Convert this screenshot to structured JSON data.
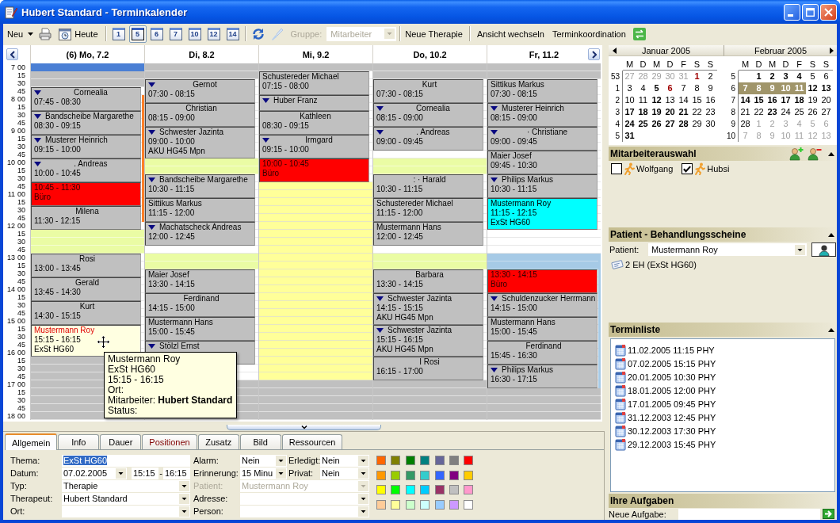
{
  "window": {
    "title": "Hubert Standard - Terminkalender"
  },
  "toolbar": {
    "new": "Neu",
    "today": "Heute",
    "day_views": [
      {
        "label": "1",
        "selected": false
      },
      {
        "label": "5",
        "selected": true
      },
      {
        "label": "6",
        "selected": false
      },
      {
        "label": "7",
        "selected": false
      },
      {
        "label": "10",
        "selected": false
      },
      {
        "label": "12",
        "selected": false
      },
      {
        "label": "14",
        "selected": false
      }
    ],
    "group": {
      "label": "Gruppe:",
      "value": "Mitarbeiter",
      "disabled": true
    },
    "new_therapy": "Neue Therapie",
    "switch_view": "Ansicht wechseln",
    "coordination": "Terminkoordination"
  },
  "calendar": {
    "times": [
      {
        "hour": "7",
        "quarters": [
          "00",
          "15",
          "30",
          "45"
        ]
      },
      {
        "hour": "8",
        "quarters": [
          "00",
          "15",
          "30",
          "45"
        ]
      },
      {
        "hour": "9",
        "quarters": [
          "00",
          "15",
          "30",
          "45"
        ]
      },
      {
        "hour": "10",
        "quarters": [
          "00",
          "15",
          "30",
          "45"
        ]
      },
      {
        "hour": "11",
        "quarters": [
          "00",
          "15",
          "30",
          "45"
        ]
      },
      {
        "hour": "12",
        "quarters": [
          "00",
          "15",
          "30",
          "45"
        ]
      },
      {
        "hour": "13",
        "quarters": [
          "00",
          "15",
          "30",
          "45"
        ]
      },
      {
        "hour": "14",
        "quarters": [
          "00",
          "15",
          "30",
          "45"
        ]
      },
      {
        "hour": "15",
        "quarters": [
          "00",
          "15",
          "30",
          "45"
        ]
      },
      {
        "hour": "16",
        "quarters": [
          "00",
          "15",
          "30",
          "45"
        ]
      },
      {
        "hour": "17",
        "quarters": [
          "00",
          "15",
          "30",
          "45"
        ]
      },
      {
        "hour": "18",
        "quarters": [
          "00"
        ]
      }
    ],
    "days": [
      {
        "header": "(6) Mo, 7.2",
        "blocks": [
          {
            "kind": "selected"
          },
          {
            "kind": "off"
          },
          {
            "kind": "off"
          },
          {
            "kind": "short",
            "title": "Cornealia",
            "time": "07:45 - 08:30",
            "marker": true,
            "color": "#c0c0c0",
            "selected": false
          },
          {
            "kind": "full",
            "title": "Bandscheibe Margarethe",
            "time": "08:30 - 09:15",
            "marker": true,
            "color": "#c0c0c0",
            "selected": false
          },
          {
            "kind": "full",
            "title": "Musterer Heinrich",
            "time": "09:15 - 10:00",
            "marker": true,
            "color": "#c0c0c0",
            "selected": false
          },
          {
            "kind": "short",
            "title": ". Andreas",
            "time": "10:00 - 10:45",
            "marker": true,
            "color": "#c0c0c0",
            "selected": false
          },
          {
            "kind": "block",
            "time": "10:45 - 11:30",
            "note": "Büro",
            "marker": false,
            "color": "#ff0000",
            "selected": false
          },
          {
            "kind": "short",
            "title": "Milena",
            "time": "11:30 - 12:15",
            "marker": false,
            "color": "#c0c0c0",
            "selected": false
          },
          {
            "kind": "break"
          },
          {
            "kind": "break"
          },
          {
            "kind": "break"
          },
          {
            "kind": "short",
            "title": "Rosi",
            "time": "13:00 - 13:45",
            "marker": false,
            "color": "#c0c0c0",
            "selected": false
          },
          {
            "kind": "short",
            "title": "Gerald",
            "time": "13:45 - 14:30",
            "marker": false,
            "color": "#c0c0c0",
            "selected": false
          },
          {
            "kind": "short",
            "title": "Kurt",
            "time": "14:30 - 15:15",
            "marker": false,
            "color": "#c0c0c0",
            "selected": false
          },
          {
            "kind": "full",
            "title": "Mustermann Roy",
            "time": "15:15 - 16:15",
            "note": "ExSt HG60",
            "marker": false,
            "color": "#ffffe1",
            "selected": true
          },
          {
            "kind": "off"
          },
          {
            "kind": "off"
          },
          {
            "kind": "off"
          },
          {
            "kind": "off"
          },
          {
            "kind": "off"
          },
          {
            "kind": "off"
          },
          {
            "kind": "off"
          },
          {
            "kind": "off"
          }
        ],
        "bar": [
          {
            "kind": "gap"
          },
          {
            "kind": "gap"
          },
          {
            "kind": "gap"
          },
          {
            "kind": "gap"
          },
          {
            "kind": "bar",
            "color": "#ff7f27"
          },
          {
            "kind": "extend"
          },
          {
            "kind": "extend"
          },
          {
            "kind": "extend"
          },
          {
            "kind": "extend"
          },
          {
            "kind": "extend"
          },
          {
            "kind": "extend"
          },
          {
            "kind": "extend"
          },
          {
            "kind": "extend"
          },
          {
            "kind": "extend"
          },
          {
            "kind": "extend"
          },
          {
            "kind": "extend"
          },
          {
            "kind": "extend"
          },
          {
            "kind": "extend"
          },
          {
            "kind": "extend"
          },
          {
            "kind": "extend"
          }
        ]
      },
      {
        "header": "Di, 8.2",
        "blocks": [
          {
            "kind": "off"
          },
          {
            "kind": "off"
          },
          {
            "kind": "short",
            "title": "Gernot",
            "time": "07:30 - 08:15",
            "marker": true,
            "color": "#c0c0c0",
            "selected": false
          },
          {
            "kind": "short",
            "title": "Christian",
            "time": "08:15 - 09:00",
            "marker": false,
            "color": "#c0c0c0",
            "selected": false
          },
          {
            "kind": "full",
            "title": "Schwester Jazinta",
            "time": "09:00 - 10:00",
            "note": "AKU HG45 Mpn",
            "marker": true,
            "color": "#c0c0c0",
            "selected": false
          },
          {
            "kind": "break"
          },
          {
            "kind": "break"
          },
          {
            "kind": "full",
            "title": "Bandscheibe Margarethe",
            "time": "10:30 - 11:15",
            "marker": true,
            "color": "#c0c0c0",
            "selected": false
          },
          {
            "kind": "full",
            "title": "Sittikus Markus",
            "time": "11:15 - 12:00",
            "marker": false,
            "color": "#c0c0c0",
            "selected": false
          },
          {
            "kind": "full",
            "title": "Machatscheck Andreas",
            "time": "12:00 - 12:45",
            "marker": true,
            "color": "#c0c0c0",
            "selected": false
          },
          {
            "kind": "free"
          },
          {
            "kind": "break"
          },
          {
            "kind": "break"
          },
          {
            "kind": "full",
            "title": "Maier Josef",
            "time": "13:30 - 14:15",
            "marker": false,
            "color": "#c0c0c0",
            "selected": false
          },
          {
            "kind": "short",
            "title": "Ferdinand",
            "time": "14:15 - 15:00",
            "marker": false,
            "color": "#c0c0c0",
            "selected": false
          },
          {
            "kind": "full",
            "title": "Mustermann Hans",
            "time": "15:00 - 15:45",
            "marker": false,
            "color": "#c0c0c0",
            "selected": false
          },
          {
            "kind": "full",
            "title": "Stölzl Ernst",
            "marker": true,
            "color": "#c0c0c0",
            "selected": false
          },
          {
            "kind": "free"
          },
          {
            "kind": "free"
          },
          {
            "kind": "off"
          },
          {
            "kind": "off"
          },
          {
            "kind": "off"
          },
          {
            "kind": "off"
          },
          {
            "kind": "off"
          }
        ]
      },
      {
        "header": "Mi, 9.2",
        "blocks": [
          {
            "kind": "off"
          },
          {
            "kind": "full",
            "title": "Schustereder Michael",
            "time": "07:15 - 08:00",
            "marker": false,
            "color": "#c0c0c0",
            "selected": false
          },
          {
            "kind": "full",
            "title": "Huber Franz",
            "marker": true,
            "color": "#c0c0c0",
            "selected": false
          },
          {
            "kind": "short",
            "title": "Kathleen",
            "time": "08:30 - 09:15",
            "marker": false,
            "color": "#c0c0c0",
            "selected": false
          },
          {
            "kind": "short",
            "title": "Irmgard",
            "time": "09:15 - 10:00",
            "marker": true,
            "color": "#c0c0c0",
            "selected": false
          },
          {
            "kind": "block",
            "time": "10:00 - 10:45",
            "note": "Büro",
            "marker": false,
            "color": "#ff0000",
            "selected": false
          },
          {
            "kind": "reserved"
          },
          {
            "kind": "reserved"
          },
          {
            "kind": "reserved"
          },
          {
            "kind": "reserved"
          },
          {
            "kind": "reserved"
          },
          {
            "kind": "reserved"
          },
          {
            "kind": "reserved"
          },
          {
            "kind": "reserved"
          },
          {
            "kind": "reserved"
          },
          {
            "kind": "reserved"
          },
          {
            "kind": "reserved"
          },
          {
            "kind": "reserved"
          },
          {
            "kind": "reserved"
          },
          {
            "kind": "reserved"
          },
          {
            "kind": "reserved"
          },
          {
            "kind": "reserved"
          },
          {
            "kind": "reserved"
          },
          {
            "kind": "reserved"
          },
          {
            "kind": "reserved"
          },
          {
            "kind": "reserved"
          },
          {
            "kind": "reserved"
          },
          {
            "kind": "reserved"
          },
          {
            "kind": "reserved"
          },
          {
            "kind": "reserved"
          },
          {
            "kind": "reserved"
          },
          {
            "kind": "off"
          },
          {
            "kind": "off"
          },
          {
            "kind": "off"
          },
          {
            "kind": "off"
          },
          {
            "kind": "off"
          }
        ]
      },
      {
        "header": "Do, 10.2",
        "blocks": [
          {
            "kind": "off"
          },
          {
            "kind": "off"
          },
          {
            "kind": "short",
            "title": "Kurt",
            "time": "07:30 - 08:15",
            "marker": false,
            "color": "#c0c0c0",
            "selected": false
          },
          {
            "kind": "short",
            "title": "Cornealia",
            "time": "08:15 - 09:00",
            "marker": true,
            "color": "#c0c0c0",
            "selected": false
          },
          {
            "kind": "short",
            "title": ". Andreas",
            "time": "09:00 - 09:45",
            "marker": true,
            "color": "#c0c0c0",
            "selected": false
          },
          {
            "kind": "free"
          },
          {
            "kind": "break"
          },
          {
            "kind": "break"
          },
          {
            "kind": "short",
            "title": ": · Harald",
            "time": "10:30 - 11:15",
            "marker": false,
            "color": "#c0c0c0",
            "selected": false
          },
          {
            "kind": "full",
            "title": "Schustereder Michael",
            "time": "11:15 - 12:00",
            "marker": false,
            "color": "#c0c0c0",
            "selected": false
          },
          {
            "kind": "full",
            "title": "Mustermann Hans",
            "time": "12:00 - 12:45",
            "marker": false,
            "color": "#c0c0c0",
            "selected": false
          },
          {
            "kind": "free"
          },
          {
            "kind": "break"
          },
          {
            "kind": "break"
          },
          {
            "kind": "short",
            "title": "Barbara",
            "time": "13:30 - 14:15",
            "marker": false,
            "color": "#c0c0c0",
            "selected": false
          },
          {
            "kind": "full",
            "title": "Schwester Jazinta",
            "time": "14:15 - 15:15",
            "note": "AKU HG45 Mpn",
            "marker": true,
            "color": "#c0c0c0",
            "selected": false
          },
          {
            "kind": "full",
            "title": "Schwester Jazinta",
            "time": "15:15 - 16:15",
            "note": "AKU HG45 Mpn",
            "marker": true,
            "color": "#c0c0c0",
            "selected": false
          },
          {
            "kind": "short",
            "title": "I Rosi",
            "time": "16:15 - 17:00",
            "marker": false,
            "color": "#c0c0c0",
            "selected": false
          },
          {
            "kind": "off"
          },
          {
            "kind": "off"
          },
          {
            "kind": "off"
          },
          {
            "kind": "off"
          },
          {
            "kind": "off"
          }
        ]
      },
      {
        "header": "Fr, 11.2",
        "blocks": [
          {
            "kind": "off"
          },
          {
            "kind": "off"
          },
          {
            "kind": "full",
            "title": "Sittikus Markus",
            "time": "07:30 - 08:15",
            "marker": false,
            "color": "#c0c0c0",
            "selected": false
          },
          {
            "kind": "full",
            "title": "Musterer Heinrich",
            "time": "08:15 - 09:00",
            "marker": true,
            "color": "#c0c0c0",
            "selected": false
          },
          {
            "kind": "short",
            "title": "· Christiane",
            "time": "09:00 - 09:45",
            "marker": true,
            "color": "#c0c0c0",
            "selected": false
          },
          {
            "kind": "full",
            "title": "Maier Josef",
            "time": "09:45 - 10:30",
            "marker": false,
            "color": "#c0c0c0",
            "selected": false
          },
          {
            "kind": "full",
            "title": "Philips Markus",
            "time": "10:30 - 11:15",
            "marker": true,
            "color": "#c0c0c0",
            "selected": false
          },
          {
            "kind": "full",
            "title": "Mustermann Roy",
            "time": "11:15 - 12:15",
            "note": "ExSt HG60",
            "marker": false,
            "color": "#00ffff",
            "selected": false
          },
          {
            "kind": "free"
          },
          {
            "kind": "free"
          },
          {
            "kind": "free"
          },
          {
            "kind": "blocked"
          },
          {
            "kind": "blocked"
          },
          {
            "kind": "block",
            "time": "13:30 - 14:15",
            "note": "Büro",
            "marker": false,
            "color": "#ff0000",
            "selected": false
          },
          {
            "kind": "full",
            "title": "Schuldenzucker Herrmann",
            "time": "14:15 - 15:00",
            "marker": true,
            "color": "#c0c0c0",
            "selected": false
          },
          {
            "kind": "full",
            "title": "Mustermann Hans",
            "time": "15:00 - 15:45",
            "marker": false,
            "color": "#c0c0c0",
            "selected": false
          },
          {
            "kind": "short",
            "title": "Ferdinand",
            "time": "15:45 - 16:30",
            "marker": false,
            "color": "#c0c0c0",
            "selected": false
          },
          {
            "kind": "full",
            "title": "Philips Markus",
            "time": "16:30 - 17:15",
            "marker": true,
            "color": "#c0c0c0",
            "selected": false
          },
          {
            "kind": "off"
          },
          {
            "kind": "off"
          },
          {
            "kind": "off"
          },
          {
            "kind": "off"
          }
        ],
        "bar": [
          {
            "kind": "gap"
          },
          {
            "kind": "gap"
          },
          {
            "kind": "gap"
          },
          {
            "kind": "gap"
          },
          {
            "kind": "gap"
          },
          {
            "kind": "gap"
          },
          {
            "kind": "gap"
          },
          {
            "kind": "gap"
          },
          {
            "kind": "gap"
          },
          {
            "kind": "gap"
          },
          {
            "kind": "gap"
          },
          {
            "kind": "gap"
          },
          {
            "kind": "gap"
          },
          {
            "kind": "gap"
          },
          {
            "kind": "gap"
          },
          {
            "kind": "gap"
          },
          {
            "kind": "gap"
          },
          {
            "kind": "gap"
          },
          {
            "kind": "gap"
          },
          {
            "kind": "gap"
          },
          {
            "kind": "gap"
          },
          {
            "kind": "gap"
          },
          {
            "kind": "gap"
          },
          {
            "kind": "gap"
          },
          {
            "kind": "bar",
            "color": "#a6cae6"
          },
          {
            "kind": "extend"
          },
          {
            "kind": "extend"
          },
          {
            "kind": "extend"
          },
          {
            "kind": "extend"
          },
          {
            "kind": "extend"
          },
          {
            "kind": "extend"
          },
          {
            "kind": "extend"
          },
          {
            "kind": "extend"
          },
          {
            "kind": "extend"
          },
          {
            "kind": "extend"
          },
          {
            "kind": "extend"
          },
          {
            "kind": "extend"
          },
          {
            "kind": "extend"
          },
          {
            "kind": "extend"
          },
          {
            "kind": "extend"
          },
          {
            "kind": "extend"
          }
        ]
      }
    ]
  },
  "tooltip": {
    "lines": [
      "Mustermann Roy",
      "ExSt HG60",
      "15:15 - 16:15",
      "Ort:",
      "Mitarbeiter: **Hubert Standard**",
      "Status:"
    ]
  },
  "details": {
    "tabs": [
      {
        "label": "Allgemein",
        "selected": true,
        "color": "#000000"
      },
      {
        "label": "Info",
        "selected": false,
        "color": "#000000"
      },
      {
        "label": "Dauer",
        "selected": false,
        "color": "#000000"
      },
      {
        "label": "Positionen",
        "selected": false,
        "color": "#800000"
      },
      {
        "label": "Zusatz",
        "selected": false,
        "color": "#000000"
      },
      {
        "label": "Bild",
        "selected": false,
        "color": "#000000"
      },
      {
        "label": "Ressourcen",
        "selected": false,
        "color": "#000000"
      }
    ],
    "rows": [
      [
        {
          "label": "Thema:",
          "kind": "text",
          "value": "ExSt HG60",
          "highlighted": true,
          "disabled": false
        },
        {
          "label": "Alarm:",
          "kind": "combo",
          "value": "Nein",
          "disabled": false
        },
        {
          "label": "Erledigt:",
          "kind": "combo",
          "value": "Nein",
          "disabled": false
        }
      ],
      [
        {
          "label": "Datum:",
          "kind": "date",
          "value": "07.02.2005",
          "start": "15:15",
          "separator": "-",
          "end": "16:15",
          "disabled": false
        },
        {
          "label": "Erinnerung:",
          "kind": "combo",
          "value": "15 Minu",
          "disabled": false
        },
        {
          "label": "Privat:",
          "kind": "combo",
          "value": "Nein",
          "disabled": false
        }
      ],
      [
        {
          "label": "Typ:",
          "kind": "combo",
          "value": "Therapie",
          "disabled": false
        },
        {
          "label": "Patient:",
          "kind": "combo",
          "value": "Mustermann Roy",
          "disabled": true
        }
      ],
      [
        {
          "label": "Therapeut:",
          "kind": "combo",
          "value": "Hubert Standard",
          "disabled": false
        },
        {
          "label": "Adresse:",
          "kind": "combo",
          "disabled": false
        }
      ],
      [
        {
          "label": "Ort:",
          "kind": "combo",
          "disabled": false
        },
        {
          "label": "Person:",
          "kind": "combo",
          "disabled": false
        }
      ]
    ],
    "palette": [
      {
        "color": "#ff6600"
      },
      {
        "color": "#808000"
      },
      {
        "color": "#008000"
      },
      {
        "color": "#008080"
      },
      {
        "color": "#666699"
      },
      {
        "color": "#808080"
      },
      {
        "color": "#ff0000"
      },
      {
        "color": "#ff9900"
      },
      {
        "color": "#99cc00"
      },
      {
        "color": "#339966"
      },
      {
        "color": "#33cccc"
      },
      {
        "color": "#3366ff"
      },
      {
        "color": "#800080"
      },
      {
        "color": "#ffcc00"
      },
      {
        "color": "#ffff00"
      },
      {
        "color": "#00ff00"
      },
      {
        "color": "#00ffff"
      },
      {
        "color": "#00ccff"
      },
      {
        "color": "#993366"
      },
      {
        "color": "#c0c0c0"
      },
      {
        "color": "#ff99cc"
      },
      {
        "color": "#ffcc99"
      },
      {
        "color": "#ffff99"
      },
      {
        "color": "#ccffcc"
      },
      {
        "color": "#ccffff"
      },
      {
        "color": "#99ccff"
      },
      {
        "color": "#cc99ff"
      },
      {
        "color": "#ffffff"
      }
    ]
  },
  "mini_calendar": {
    "months": [
      {
        "title": "Januar 2005",
        "weekdays": [
          "M",
          "D",
          "M",
          "D",
          "F",
          "S",
          "S"
        ],
        "weeks": [
          {
            "number": "53",
            "days": [
              {
                "label": "27",
                "kind": "outside",
                "selected": false
              },
              {
                "label": "28",
                "kind": "outside",
                "selected": false
              },
              {
                "label": "29",
                "kind": "outside",
                "selected": false
              },
              {
                "label": "30",
                "kind": "outside",
                "selected": false
              },
              {
                "label": "31",
                "kind": "outside",
                "selected": false
              },
              {
                "label": "1",
                "kind": "holiday",
                "selected": false
              },
              {
                "label": "2",
                "kind": "plain",
                "selected": false
              }
            ]
          },
          {
            "number": "1",
            "days": [
              {
                "label": "3",
                "kind": "plain",
                "selected": false
              },
              {
                "label": "4",
                "kind": "plain",
                "selected": false
              },
              {
                "label": "5",
                "kind": "busy",
                "selected": false
              },
              {
                "label": "6",
                "kind": "holiday",
                "selected": false
              },
              {
                "label": "7",
                "kind": "plain",
                "selected": false
              },
              {
                "label": "8",
                "kind": "plain",
                "selected": false
              },
              {
                "label": "9",
                "kind": "plain",
                "selected": false
              }
            ]
          },
          {
            "number": "2",
            "days": [
              {
                "label": "10",
                "kind": "plain",
                "selected": false
              },
              {
                "label": "11",
                "kind": "plain",
                "selected": false
              },
              {
                "label": "12",
                "kind": "busy",
                "selected": false
              },
              {
                "label": "13",
                "kind": "plain",
                "selected": false
              },
              {
                "label": "14",
                "kind": "plain",
                "selected": false
              },
              {
                "label": "15",
                "kind": "plain",
                "selected": false
              },
              {
                "label": "16",
                "kind": "plain",
                "selected": false
              }
            ]
          },
          {
            "number": "3",
            "days": [
              {
                "label": "17",
                "kind": "busy",
                "selected": false
              },
              {
                "label": "18",
                "kind": "busy",
                "selected": false
              },
              {
                "label": "19",
                "kind": "busy",
                "selected": false
              },
              {
                "label": "20",
                "kind": "busy",
                "selected": false
              },
              {
                "label": "21",
                "kind": "busy",
                "selected": false
              },
              {
                "label": "22",
                "kind": "plain",
                "selected": false
              },
              {
                "label": "23",
                "kind": "plain",
                "selected": false
              }
            ]
          },
          {
            "number": "4",
            "days": [
              {
                "label": "24",
                "kind": "busy",
                "selected": false
              },
              {
                "label": "25",
                "kind": "busy",
                "selected": false
              },
              {
                "label": "26",
                "kind": "busy",
                "selected": false
              },
              {
                "label": "27",
                "kind": "busy",
                "selected": false
              },
              {
                "label": "28",
                "kind": "busy",
                "selected": false
              },
              {
                "label": "29",
                "kind": "plain",
                "selected": false
              },
              {
                "label": "30",
                "kind": "plain",
                "selected": false
              }
            ]
          },
          {
            "number": "5",
            "days": [
              {
                "label": "31",
                "kind": "busy",
                "selected": false
              }
            ]
          }
        ]
      },
      {
        "title": "Februar 2005",
        "weekdays": [
          "M",
          "D",
          "M",
          "D",
          "F",
          "S",
          "S"
        ],
        "weeks": [
          {
            "number": "5",
            "days": [
              {
                "label": "1",
                "kind": "busy",
                "selected": false
              },
              {
                "label": "2",
                "kind": "busy",
                "selected": false
              },
              {
                "label": "3",
                "kind": "busy",
                "selected": false
              },
              {
                "label": "4",
                "kind": "busy",
                "selected": false
              },
              {
                "label": "5",
                "kind": "plain",
                "selected": false
              },
              {
                "label": "6",
                "kind": "plain",
                "selected": false
              }
            ]
          },
          {
            "number": "6",
            "days": [
              {
                "label": "7",
                "kind": "busy",
                "selected": true
              },
              {
                "label": "8",
                "kind": "busy",
                "selected": true
              },
              {
                "label": "9",
                "kind": "busy",
                "selected": true
              },
              {
                "label": "10",
                "kind": "busy",
                "selected": true
              },
              {
                "label": "11",
                "kind": "busy",
                "selected": true
              },
              {
                "label": "12",
                "kind": "busy",
                "selected": false
              },
              {
                "label": "13",
                "kind": "busy",
                "selected": false
              }
            ]
          },
          {
            "number": "7",
            "days": [
              {
                "label": "14",
                "kind": "busy",
                "selected": false
              },
              {
                "label": "15",
                "kind": "busy",
                "selected": false
              },
              {
                "label": "16",
                "kind": "busy",
                "selected": false
              },
              {
                "label": "17",
                "kind": "busy",
                "selected": false
              },
              {
                "label": "18",
                "kind": "busy",
                "selected": false
              },
              {
                "label": "19",
                "kind": "plain",
                "selected": false
              },
              {
                "label": "20",
                "kind": "plain",
                "selected": false
              }
            ]
          },
          {
            "number": "8",
            "days": [
              {
                "label": "21",
                "kind": "plain",
                "selected": false
              },
              {
                "label": "22",
                "kind": "plain",
                "selected": false
              },
              {
                "label": "23",
                "kind": "busy",
                "selected": false
              },
              {
                "label": "24",
                "kind": "plain",
                "selected": false
              },
              {
                "label": "25",
                "kind": "plain",
                "selected": false
              },
              {
                "label": "26",
                "kind": "plain",
                "selected": false
              },
              {
                "label": "27",
                "kind": "plain",
                "selected": false
              }
            ]
          },
          {
            "number": "9",
            "days": [
              {
                "label": "28",
                "kind": "plain",
                "selected": false
              },
              {
                "label": "1",
                "kind": "outside",
                "selected": false
              },
              {
                "label": "2",
                "kind": "outside",
                "selected": false
              },
              {
                "label": "3",
                "kind": "outside",
                "selected": false
              },
              {
                "label": "4",
                "kind": "outside",
                "selected": false
              },
              {
                "label": "5",
                "kind": "outside",
                "selected": false
              },
              {
                "label": "6",
                "kind": "outside",
                "selected": false
              }
            ]
          },
          {
            "number": "10",
            "days": [
              {
                "label": "7",
                "kind": "outside",
                "selected": false
              },
              {
                "label": "8",
                "kind": "outside",
                "selected": false
              },
              {
                "label": "9",
                "kind": "outside",
                "selected": false
              },
              {
                "label": "10",
                "kind": "outside",
                "selected": false
              },
              {
                "label": "11",
                "kind": "outside",
                "selected": false
              },
              {
                "label": "12",
                "kind": "outside",
                "selected": false
              },
              {
                "label": "13",
                "kind": "outside",
                "selected": false
              }
            ]
          }
        ]
      }
    ]
  },
  "staff": {
    "title": "Mitarbeiterauswahl",
    "members": [
      {
        "name": "Wolfgang",
        "checked": false
      },
      {
        "name": "Hubsi",
        "checked": true
      }
    ]
  },
  "patient": {
    "title": "Patient - Behandlungsscheine",
    "label": "Patient:",
    "value": "Mustermann Roy",
    "vouchers": [
      "2 EH (ExSt HG60)"
    ]
  },
  "appointments": {
    "title": "Terminliste",
    "items": [
      "11.02.2005 11:15 PHY",
      "07.02.2005 15:15 PHY",
      "20.01.2005 10:30 PHY",
      "18.01.2005 12:00 PHY",
      "17.01.2005 09:45 PHY",
      "31.12.2003 12:45 PHY",
      "30.12.2003 17:30 PHY",
      "29.12.2003 15:45 PHY"
    ]
  },
  "tasks": {
    "title": "Ihre Aufgaben",
    "label": "Neue Aufgabe:"
  }
}
